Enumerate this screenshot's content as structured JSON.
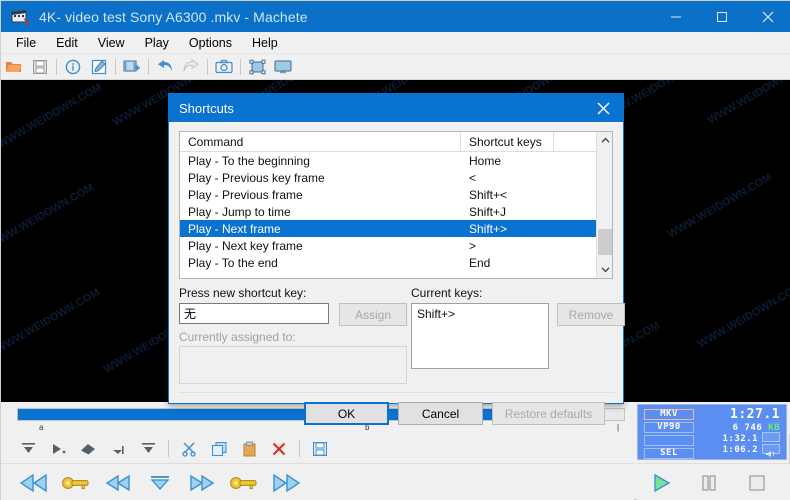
{
  "window": {
    "title": "4K- video test Sony A6300 .mkv - Machete",
    "icon": "film-clapper-icon",
    "controls": {
      "minimize": "minimize-icon",
      "maximize": "maximize-icon",
      "close": "close-icon"
    }
  },
  "menubar": {
    "items": [
      "File",
      "Edit",
      "View",
      "Play",
      "Options",
      "Help"
    ]
  },
  "toolbar": {
    "items": [
      {
        "name": "open-file-icon",
        "sep_after": false
      },
      {
        "name": "save-file-icon",
        "sep_after": true
      },
      {
        "name": "info-icon",
        "sep_after": false
      },
      {
        "name": "edit-icon",
        "sep_after": true
      },
      {
        "name": "add-clip-icon",
        "sep_after": true
      },
      {
        "name": "undo-icon",
        "sep_after": false
      },
      {
        "name": "redo-icon",
        "sep_after": true
      },
      {
        "name": "snapshot-camera-icon",
        "sep_after": true
      },
      {
        "name": "crop-frame-icon",
        "sep_after": false
      },
      {
        "name": "fullscreen-monitor-icon",
        "sep_after": false
      }
    ]
  },
  "video_area": {
    "watermark_text": "WWW.WEIDOWN.COM",
    "background_color": "#000000"
  },
  "timeline": {
    "progress_percent": 89,
    "handle_percent": 93,
    "fill_color": "#0a72d0",
    "marker_left": "a",
    "marker_mid": "b"
  },
  "edit_toolbar": {
    "items": [
      {
        "name": "set-selection-start-icon"
      },
      {
        "name": "play-selection-icon"
      },
      {
        "name": "delete-selection-icon"
      },
      {
        "name": "trim-left-icon"
      },
      {
        "name": "set-selection-end-icon"
      },
      {
        "name": "cut-scissors-icon"
      },
      {
        "name": "copy-icon"
      },
      {
        "name": "paste-clipboard-icon"
      },
      {
        "name": "delete-red-x-icon"
      },
      {
        "name": "save-selection-icon"
      }
    ]
  },
  "nav_toolbar": {
    "items": [
      {
        "name": "skip-to-start-icon"
      },
      {
        "name": "previous-key-frame-key-icon"
      },
      {
        "name": "previous-frame-icon"
      },
      {
        "name": "jump-to-time-icon"
      },
      {
        "name": "next-frame-icon"
      },
      {
        "name": "next-key-frame-key-icon"
      },
      {
        "name": "skip-to-end-icon"
      }
    ]
  },
  "info_panel": {
    "container_color": "#5b8ef0",
    "tags": [
      "MKV",
      "VP90",
      "",
      "SEL"
    ],
    "position_time": "1:27.1",
    "size_value": "6 746",
    "size_unit": "KB",
    "duration_time": "1:32.1",
    "selection_time": "1:06.2"
  },
  "play_controls": {
    "items": [
      {
        "name": "play-button",
        "glyph": "play"
      },
      {
        "name": "pause-button",
        "glyph": "pause"
      },
      {
        "name": "stop-button",
        "glyph": "stop"
      }
    ]
  },
  "dialog": {
    "title": "Shortcuts",
    "close_icon": "close-icon",
    "list": {
      "headers": [
        "Command",
        "Shortcut keys"
      ],
      "rows": [
        {
          "command": "Play - To the beginning",
          "keys": "Home",
          "selected": false
        },
        {
          "command": "Play - Previous key frame",
          "keys": "<",
          "selected": false
        },
        {
          "command": "Play - Previous frame",
          "keys": "Shift+<",
          "selected": false
        },
        {
          "command": "Play - Jump to time",
          "keys": "Shift+J",
          "selected": false
        },
        {
          "command": "Play - Next frame",
          "keys": "Shift+>",
          "selected": true
        },
        {
          "command": "Play - Next key frame",
          "keys": ">",
          "selected": false
        },
        {
          "command": "Play - To the end",
          "keys": "End",
          "selected": false
        }
      ],
      "scroll_up_icon": "chevron-up-icon",
      "scroll_down_icon": "chevron-down-icon"
    },
    "press_key_label": "Press new shortcut key:",
    "press_key_value": "无",
    "assign_button": "Assign",
    "currently_assigned_label": "Currently assigned to:",
    "currently_assigned_value": "",
    "current_keys_label": "Current keys:",
    "current_keys_value": "Shift+>",
    "remove_button": "Remove",
    "ok_button": "OK",
    "cancel_button": "Cancel",
    "restore_button": "Restore defaults"
  }
}
